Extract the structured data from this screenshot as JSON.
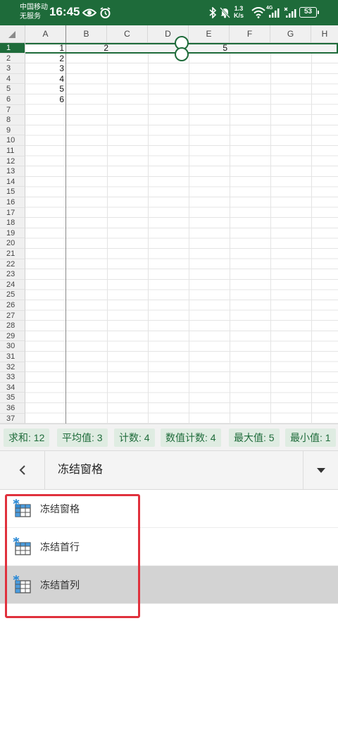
{
  "status_bar": {
    "carrier_line1": "中国移动",
    "carrier_line2": "无服务",
    "time": "16:45",
    "net_speed_value": "1.3",
    "net_speed_unit": "K/s",
    "network_badge": "4G",
    "battery": "53",
    "icons": [
      "eye-icon",
      "alarm-icon",
      "bluetooth-icon",
      "mute-icon",
      "wifi-icon",
      "signal-icon",
      "no-signal-icon",
      "battery-icon"
    ]
  },
  "sheet": {
    "columns": [
      "A",
      "B",
      "C",
      "D",
      "E",
      "F",
      "G",
      "H"
    ],
    "rows": [
      "1",
      "2",
      "3",
      "4",
      "5",
      "6",
      "7",
      "8",
      "9",
      "10",
      "11",
      "12",
      "13",
      "14",
      "15",
      "16",
      "17",
      "18",
      "19",
      "20",
      "21",
      "22",
      "23",
      "24",
      "25",
      "26",
      "27",
      "28",
      "29",
      "30",
      "31",
      "32",
      "33",
      "34",
      "35",
      "36",
      "37"
    ],
    "cells": {
      "A1": "1",
      "A2": "2",
      "A3": "3",
      "A4": "4",
      "A5": "5",
      "A6": "6",
      "B1": "2",
      "E1": "5"
    },
    "selected_row": "1"
  },
  "stats": [
    {
      "id": "sum",
      "label": "求和: 12"
    },
    {
      "id": "average",
      "label": "平均值: 3"
    },
    {
      "id": "count",
      "label": "计数: 4"
    },
    {
      "id": "numeric-count",
      "label": "数值计数: 4"
    },
    {
      "id": "max",
      "label": "最大值: 5"
    },
    {
      "id": "min",
      "label": "最小值: 1"
    }
  ],
  "menu": {
    "title": "冻结窗格",
    "options": [
      {
        "id": "freeze-panes",
        "label": "冻结窗格",
        "icon": "freeze-panes-icon",
        "highlighted": false
      },
      {
        "id": "freeze-top-row",
        "label": "冻结首行",
        "icon": "freeze-top-row-icon",
        "highlighted": false
      },
      {
        "id": "freeze-first-column",
        "label": "冻结首列",
        "icon": "freeze-first-column-icon",
        "highlighted": true
      }
    ]
  },
  "colors": {
    "brand_green": "#1e6b3a",
    "highlight_red": "#e0313d",
    "stat_chip_bg": "#dfece2",
    "icon_blue": "#2e8bd6"
  }
}
